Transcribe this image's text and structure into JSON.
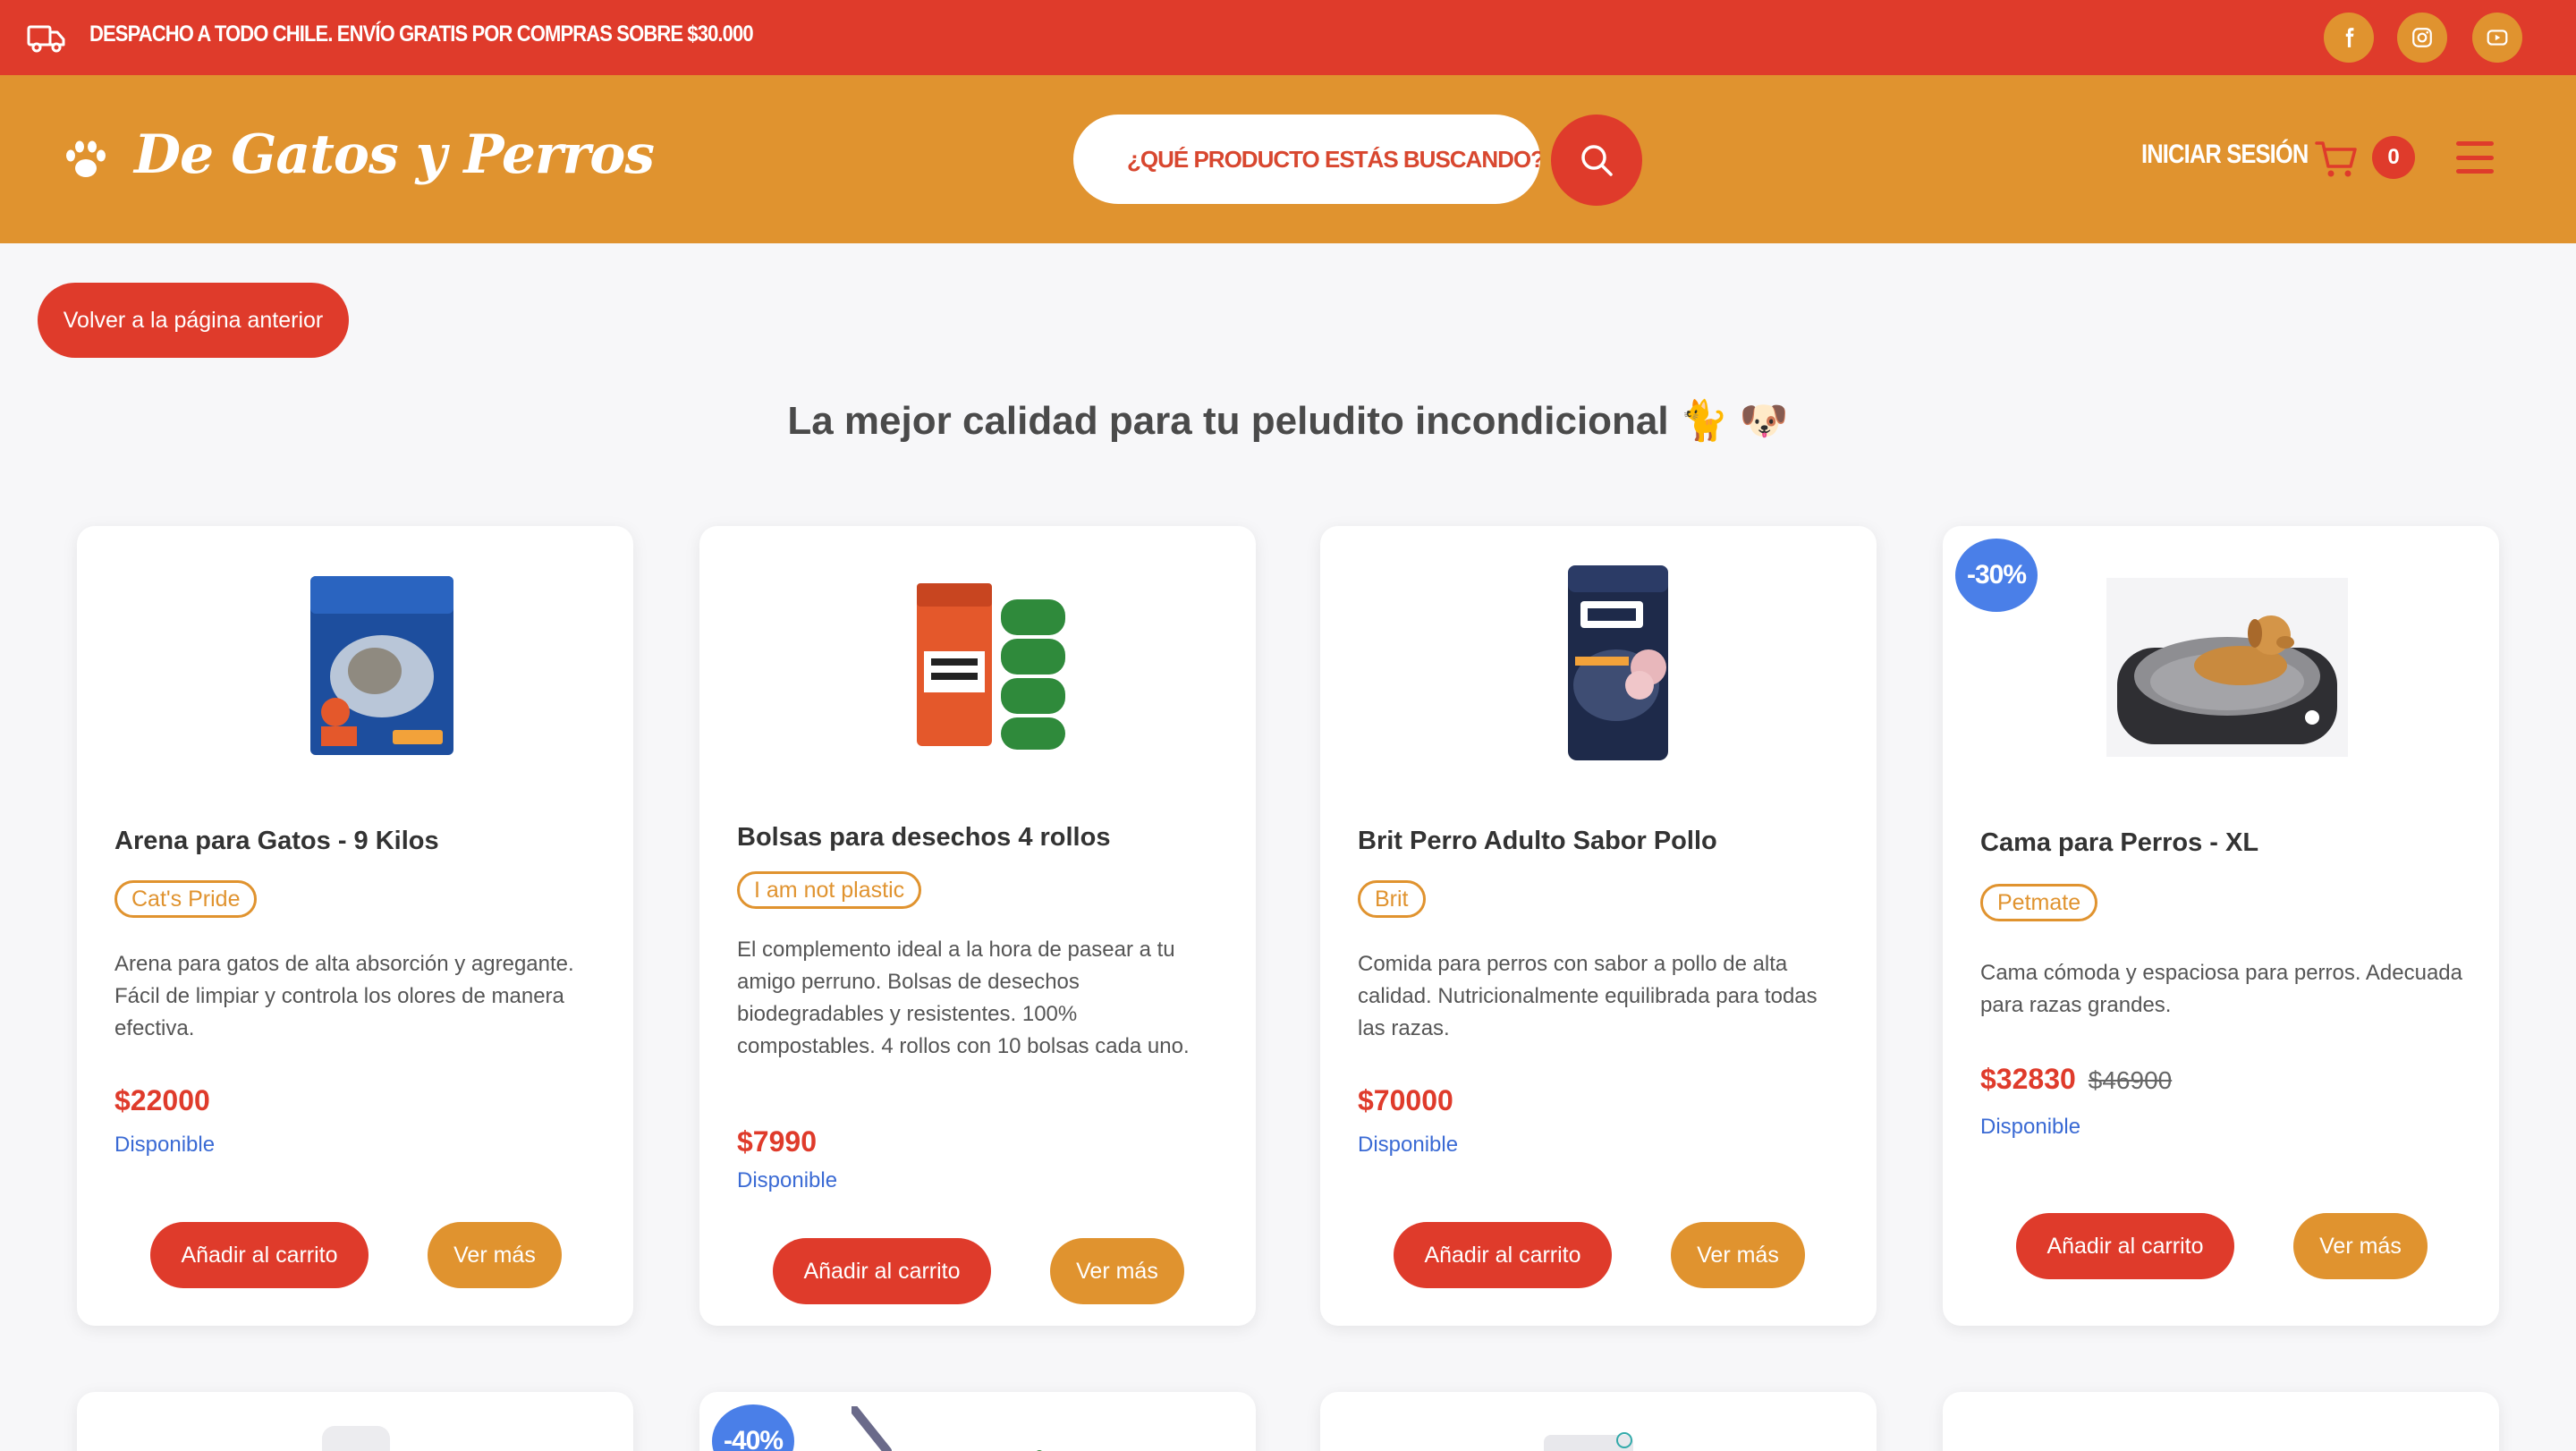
{
  "topbar": {
    "promo": "DESPACHO A TODO CHILE. ENVÍO GRATIS POR COMPRAS SOBRE $30.000",
    "social": [
      "facebook-icon",
      "instagram-icon",
      "youtube-icon"
    ]
  },
  "header": {
    "brand": "De Gatos y Perros",
    "search_placeholder": "¿QUÉ PRODUCTO ESTÁS BUSCANDO?",
    "login": "INICIAR SESIÓN",
    "cart_count": "0"
  },
  "page": {
    "back": "Volver a la página anterior",
    "tagline": "La mejor calidad para tu peludito incondicional 🐈 🐶"
  },
  "products": [
    {
      "title": "Arena para Gatos - 9 Kilos",
      "brand": "Cat's Pride",
      "description": "Arena para gatos de alta absorción y agregante. Fácil de limpiar y controla los olores de manera efectiva.",
      "price": "$22000",
      "availability": "Disponible",
      "add": "Añadir al carrito",
      "more": "Ver más"
    },
    {
      "title": "Bolsas para desechos 4 rollos",
      "brand": "I am not plastic",
      "description": "El complemento ideal a la hora de pasear a tu amigo perruno. Bolsas de desechos biodegradables y resistentes. 100% compostables. 4 rollos con 10 bolsas cada uno.",
      "price": "$7990",
      "availability": "Disponible",
      "add": "Añadir al carrito",
      "more": "Ver más"
    },
    {
      "title": "Brit Perro Adulto Sabor Pollo",
      "brand": "Brit",
      "description": "Comida para perros con sabor a pollo de alta calidad. Nutricionalmente equilibrada para todas las razas.",
      "price": "$70000",
      "availability": "Disponible",
      "add": "Añadir al carrito",
      "more": "Ver más"
    },
    {
      "discount": "-30%",
      "title": "Cama para Perros - XL",
      "brand": "Petmate",
      "description": "Cama cómoda y espaciosa para perros. Adecuada para razas grandes.",
      "price": "$32830",
      "old_price": "$46900",
      "availability": "Disponible",
      "add": "Añadir al carrito",
      "more": "Ver más"
    }
  ],
  "next_row": {
    "discount": "-40%"
  }
}
